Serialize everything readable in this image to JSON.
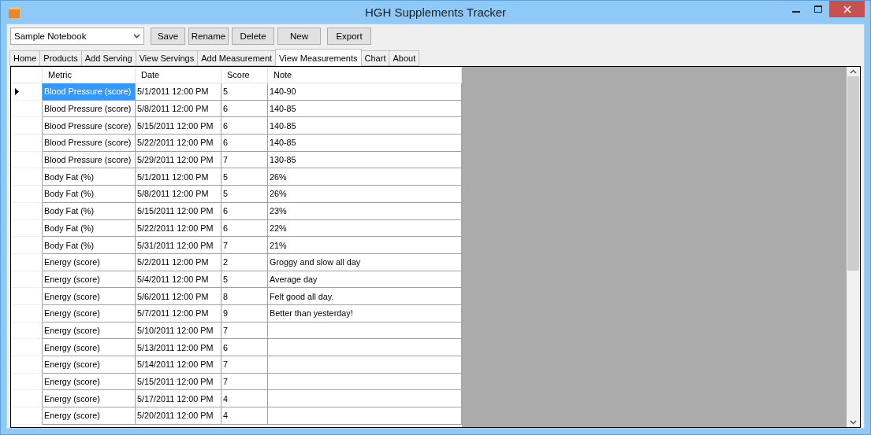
{
  "window": {
    "title": "HGH Supplements Tracker"
  },
  "notebook": {
    "value": "Sample Notebook"
  },
  "buttons": [
    "Save",
    "Rename",
    "Delete",
    "New",
    "Export"
  ],
  "tabs": [
    {
      "label": "Home",
      "selected": false
    },
    {
      "label": "Products",
      "selected": false
    },
    {
      "label": "Add Serving",
      "selected": false
    },
    {
      "label": "View Servings",
      "selected": false
    },
    {
      "label": "Add Measurement",
      "selected": false
    },
    {
      "label": "View Measurements",
      "selected": true
    },
    {
      "label": "Chart",
      "selected": false
    },
    {
      "label": "About",
      "selected": false
    }
  ],
  "table": {
    "columns": [
      "Metric",
      "Date",
      "Score",
      "Note"
    ],
    "rows": [
      {
        "selected": true,
        "cells": [
          "Blood Pressure (score)",
          "5/1/2011 12:00 PM",
          "5",
          "140-90"
        ]
      },
      {
        "selected": false,
        "cells": [
          "Blood Pressure (score)",
          "5/8/2011 12:00 PM",
          "6",
          "140-85"
        ]
      },
      {
        "selected": false,
        "cells": [
          "Blood Pressure (score)",
          "5/15/2011 12:00 PM",
          "6",
          "140-85"
        ]
      },
      {
        "selected": false,
        "cells": [
          "Blood Pressure (score)",
          "5/22/2011 12:00 PM",
          "6",
          "140-85"
        ]
      },
      {
        "selected": false,
        "cells": [
          "Blood Pressure (score)",
          "5/29/2011 12:00 PM",
          "7",
          "130-85"
        ]
      },
      {
        "selected": false,
        "cells": [
          "Body Fat (%)",
          "5/1/2011 12:00 PM",
          "5",
          "26%"
        ]
      },
      {
        "selected": false,
        "cells": [
          "Body Fat (%)",
          "5/8/2011 12:00 PM",
          "5",
          "26%"
        ]
      },
      {
        "selected": false,
        "cells": [
          "Body Fat (%)",
          "5/15/2011 12:00 PM",
          "6",
          "23%"
        ]
      },
      {
        "selected": false,
        "cells": [
          "Body Fat (%)",
          "5/22/2011 12:00 PM",
          "6",
          "22%"
        ]
      },
      {
        "selected": false,
        "cells": [
          "Body Fat (%)",
          "5/31/2011 12:00 PM",
          "7",
          "21%"
        ]
      },
      {
        "selected": false,
        "cells": [
          "Energy (score)",
          "5/2/2011 12:00 PM",
          "2",
          "Groggy and slow all day"
        ]
      },
      {
        "selected": false,
        "cells": [
          "Energy (score)",
          "5/4/2011 12:00 PM",
          "5",
          "Average day"
        ]
      },
      {
        "selected": false,
        "cells": [
          "Energy (score)",
          "5/6/2011 12:00 PM",
          "8",
          "Felt good all day."
        ]
      },
      {
        "selected": false,
        "cells": [
          "Energy (score)",
          "5/7/2011 12:00 PM",
          "9",
          "Better than yesterday!"
        ]
      },
      {
        "selected": false,
        "cells": [
          "Energy (score)",
          "5/10/2011 12:00 PM",
          "7",
          ""
        ]
      },
      {
        "selected": false,
        "cells": [
          "Energy (score)",
          "5/13/2011 12:00 PM",
          "6",
          ""
        ]
      },
      {
        "selected": false,
        "cells": [
          "Energy (score)",
          "5/14/2011 12:00 PM",
          "7",
          ""
        ]
      },
      {
        "selected": false,
        "cells": [
          "Energy (score)",
          "5/15/2011 12:00 PM",
          "7",
          ""
        ]
      },
      {
        "selected": false,
        "cells": [
          "Energy (score)",
          "5/17/2011 12:00 PM",
          "4",
          ""
        ]
      },
      {
        "selected": false,
        "cells": [
          "Energy (score)",
          "5/20/2011 12:00 PM",
          "4",
          ""
        ]
      }
    ]
  }
}
